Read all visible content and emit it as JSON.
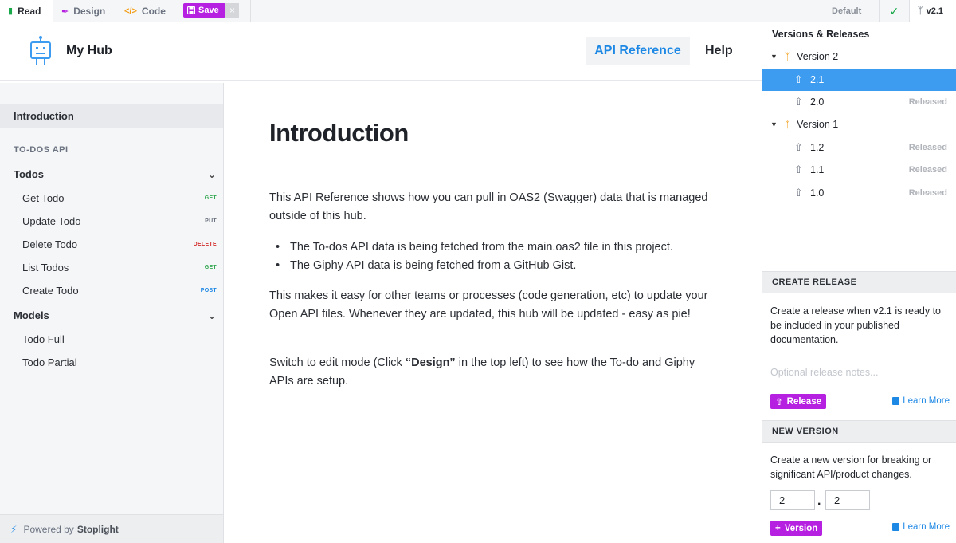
{
  "toolbar": {
    "tabs": [
      {
        "label": "Read",
        "icon": "book-icon"
      },
      {
        "label": "Design",
        "icon": "brush-icon"
      },
      {
        "label": "Code",
        "icon": "code-icon"
      }
    ],
    "save_label": "Save",
    "close_symbol": "×",
    "env_label": "Default",
    "version_label": "v2.1"
  },
  "header": {
    "hub_name": "My Hub",
    "nav": [
      "API Reference",
      "Help"
    ]
  },
  "sidebar": {
    "intro": "Introduction",
    "section": "TO-DOS API",
    "groups": [
      {
        "label": "Todos",
        "items": [
          {
            "label": "Get Todo",
            "method": "GET"
          },
          {
            "label": "Update Todo",
            "method": "PUT"
          },
          {
            "label": "Delete Todo",
            "method": "DELETE"
          },
          {
            "label": "List Todos",
            "method": "GET"
          },
          {
            "label": "Create Todo",
            "method": "POST"
          }
        ]
      },
      {
        "label": "Models",
        "items": [
          {
            "label": "Todo Full"
          },
          {
            "label": "Todo Partial"
          }
        ]
      }
    ],
    "footer_prefix": "Powered by",
    "footer_brand": "Stoplight"
  },
  "content": {
    "title": "Introduction",
    "para1": "This API Reference shows how you can pull in OAS2 (Swagger) data that is managed outside of this hub.",
    "bullets": [
      "The To-dos API data is being fetched from the main.oas2 file in this project.",
      "The Giphy API data is being fetched from a GitHub Gist."
    ],
    "para2": "This makes it easy for other teams or processes (code generation, etc) to update your Open API files. Whenever they are updated, this hub will be updated - easy as pie!",
    "para3_pre": "Switch to edit mode (Click ",
    "para3_bold": "“Design”",
    "para3_post": " in the top left) to see how the To-do and Giphy APIs are setup."
  },
  "versions": {
    "title": "Versions & Releases",
    "groups": [
      {
        "label": "Version 2",
        "releases": [
          {
            "num": "2.1",
            "status": "",
            "selected": true
          },
          {
            "num": "2.0",
            "status": "Released",
            "selected": false
          }
        ]
      },
      {
        "label": "Version 1",
        "releases": [
          {
            "num": "1.2",
            "status": "Released",
            "selected": false
          },
          {
            "num": "1.1",
            "status": "Released",
            "selected": false
          },
          {
            "num": "1.0",
            "status": "Released",
            "selected": false
          }
        ]
      }
    ]
  },
  "create_release": {
    "heading": "CREATE RELEASE",
    "text": "Create a release when v2.1 is ready to be included in your published documentation.",
    "notes_placeholder": "Optional release notes...",
    "button": "Release",
    "learn": "Learn More"
  },
  "new_version": {
    "heading": "NEW VERSION",
    "text": "Create a new version for breaking or significant API/product changes.",
    "major": "2",
    "minor": "2",
    "button": "Version",
    "learn": "Learn More"
  },
  "colors": {
    "accent_purple": "#b620e0",
    "link_blue": "#1e88e5",
    "selected_blue": "#3d9bf0",
    "branch_orange": "#f39c12",
    "check_green": "#19a84a"
  }
}
